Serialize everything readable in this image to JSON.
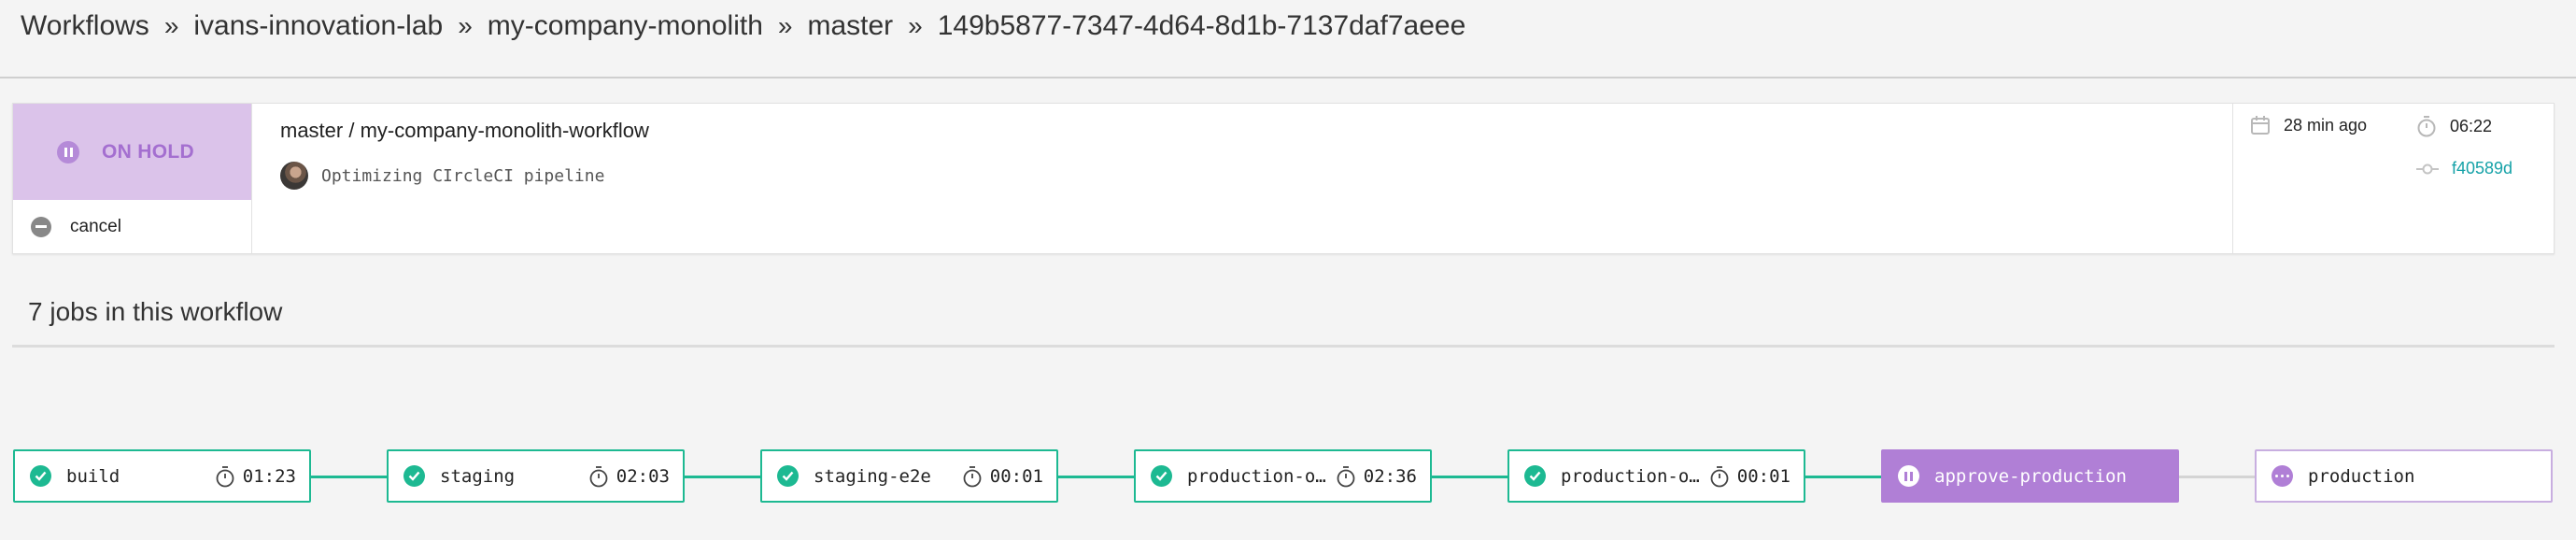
{
  "breadcrumb": {
    "items": [
      "Workflows",
      "ivans-innovation-lab",
      "my-company-monolith",
      "master",
      "149b5877-7347-4d64-8d1b-7137daf7aeee"
    ],
    "separator": "»"
  },
  "workflow": {
    "status": "ON HOLD",
    "cancel_label": "cancel",
    "title": "master / my-company-monolith-workflow",
    "commit_message": "Optimizing CIrcleCI pipeline",
    "started": "28 min ago",
    "duration": "06:22",
    "commit_hash": "f40589d"
  },
  "jobs_heading": "7 jobs in this workflow",
  "jobs": [
    {
      "name": "build",
      "duration": "01:23",
      "status": "success"
    },
    {
      "name": "staging",
      "duration": "02:03",
      "status": "success"
    },
    {
      "name": "staging-e2e",
      "duration": "00:01",
      "status": "success"
    },
    {
      "name": "production-o…",
      "duration": "02:36",
      "status": "success"
    },
    {
      "name": "production-o…",
      "duration": "00:01",
      "status": "success"
    },
    {
      "name": "approve-production",
      "duration": "",
      "status": "on-hold"
    },
    {
      "name": "production",
      "duration": "",
      "status": "pending"
    }
  ],
  "colors": {
    "success": "#1db992",
    "on_hold": "#b07fd6",
    "status_bg": "#dbc3ea",
    "link": "#16a2a8"
  },
  "icons": {
    "status": "pause-circle-icon",
    "cancel": "minus-circle-icon",
    "started": "calendar-icon",
    "duration": "stopwatch-icon",
    "commit": "commit-icon",
    "job_success": "check-circle-icon",
    "job_hold": "pause-circle-icon",
    "job_pending": "ellipsis-circle-icon"
  }
}
